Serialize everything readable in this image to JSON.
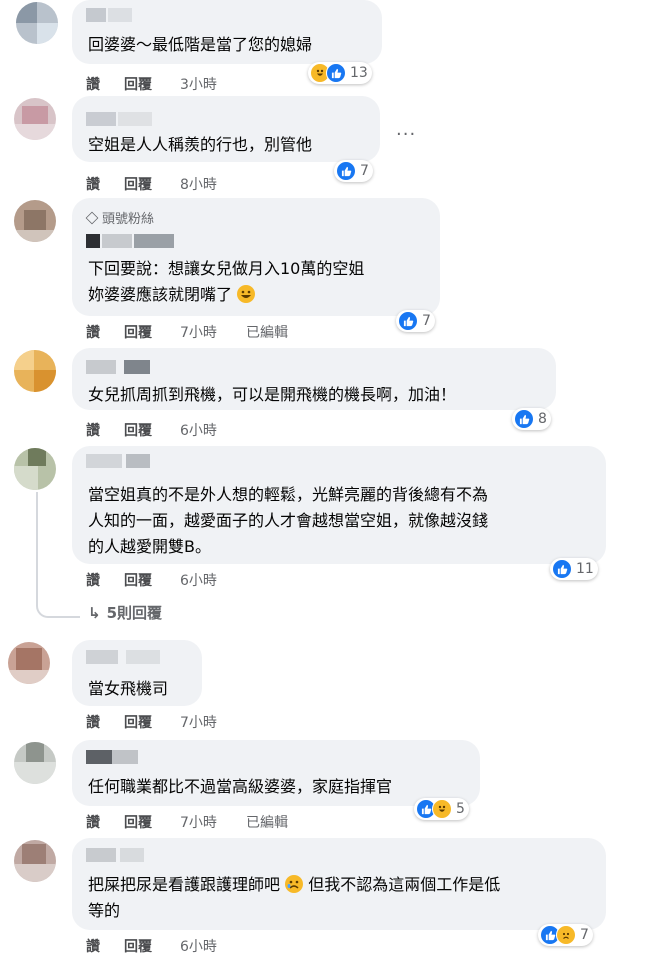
{
  "actions": {
    "like": "讚",
    "reply": "回覆",
    "edited": "已編輯"
  },
  "comments": [
    {
      "text_lines": [
        "回婆婆～最低階是當了您的媳婦"
      ],
      "time": "3小時",
      "reaction_count": "13",
      "reactions": [
        "haha",
        "like"
      ]
    },
    {
      "text_lines": [
        "空姐是人人稱羨的行也，別管他"
      ],
      "time": "8小時",
      "reaction_count": "7",
      "reactions": [
        "like"
      ]
    },
    {
      "badge": "頭號粉絲",
      "text_lines": [
        "下回要說：想讓女兒做月入10萬的空姐",
        "妳婆婆應該就閉嘴了"
      ],
      "time": "7小時",
      "edited": true,
      "reaction_count": "7",
      "reactions": [
        "like"
      ]
    },
    {
      "text_lines": [
        "女兒抓周抓到飛機，可以是開飛機的機長啊，加油！"
      ],
      "time": "6小時",
      "reaction_count": "8",
      "reactions": [
        "like"
      ]
    },
    {
      "text_lines": [
        "當空姐真的不是外人想的輕鬆，光鮮亮麗的背後總有不為",
        "人知的一面，越愛面子的人才會越想當空姐，就像越沒錢",
        "的人越愛開雙B。"
      ],
      "time": "6小時",
      "reaction_count": "11",
      "reactions": [
        "like"
      ],
      "replies_label": "5則回覆"
    },
    {
      "text_lines": [
        "當女飛機司"
      ],
      "time": "7小時"
    },
    {
      "text_lines": [
        "任何職業都比不過當高級婆婆，家庭指揮官"
      ],
      "time": "7小時",
      "edited": true,
      "reaction_count": "5",
      "reactions": [
        "like",
        "haha"
      ]
    },
    {
      "text_lines": [
        "把屎把尿是看護跟護理師吧",
        "等的"
      ],
      "text_line1_tail": "但我不認為這兩個工作是低",
      "time": "6小時",
      "reaction_count": "7",
      "reactions": [
        "like",
        "sad"
      ]
    }
  ],
  "more_menu": "···",
  "colors": {
    "bubble": "#f0f2f5",
    "like": "#1877f2",
    "haha": "#f7b928",
    "meta": "#65676b"
  }
}
